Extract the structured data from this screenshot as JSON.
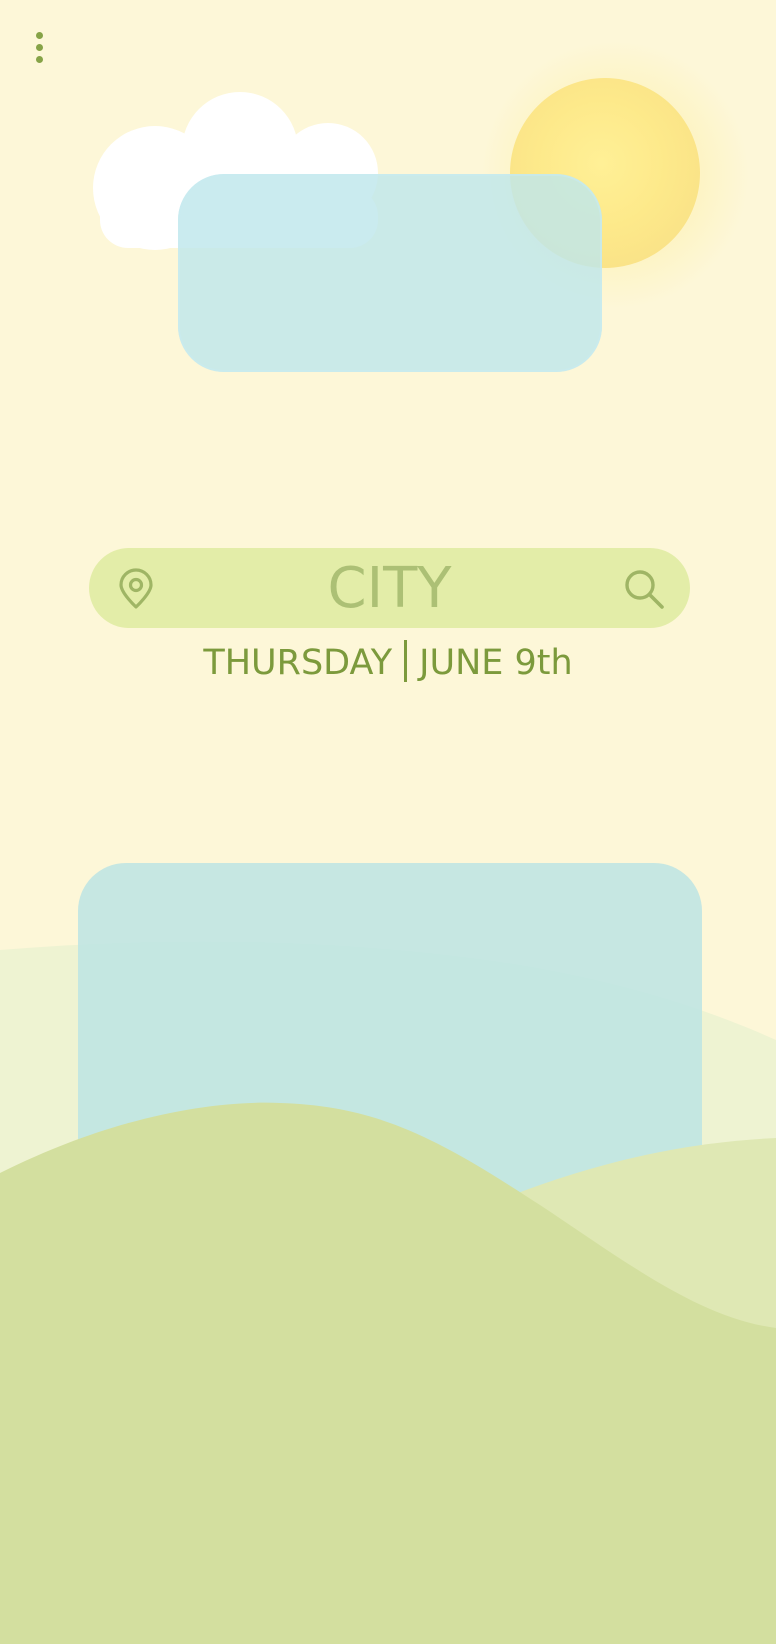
{
  "menu": {
    "icon": "more-vert-icon"
  },
  "search": {
    "placeholder": "CITY",
    "value": "",
    "location_icon": "location-pin-icon",
    "search_icon": "search-icon"
  },
  "date": {
    "day": "THURSDAY",
    "date": "JUNE 9th"
  },
  "colors": {
    "background": "#fdf7d8",
    "accent": "#7c9a3c",
    "search_bar": "#e3eda8",
    "card": "#bee6eb",
    "hill_front": "#d3df9f",
    "hill_back": "#dfe9b5"
  }
}
